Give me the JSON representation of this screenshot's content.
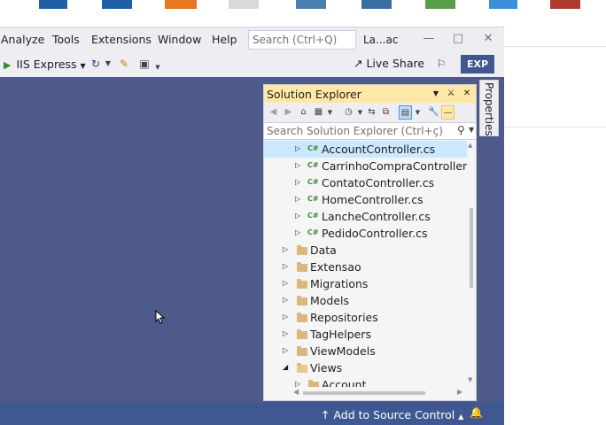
{
  "menu": {
    "items": [
      "Analyze",
      "Tools",
      "Extensions",
      "Window",
      "Help"
    ],
    "search_placeholder": "Search (Ctrl+Q)",
    "window_title": "La...ac"
  },
  "toolbar": {
    "run_label": "IIS Express",
    "live_share_label": "Live Share",
    "exp_badge": "EXP"
  },
  "properties_tab": "Properties",
  "solution_explorer": {
    "title": "Solution Explorer",
    "search_placeholder": "Search Solution Explorer (Ctrl+ç)",
    "cs_icon": "C#",
    "tree": [
      {
        "label": "AccountController.cs",
        "kind": "cs",
        "selected": true
      },
      {
        "label": "CarrinhoCompraController.cs",
        "kind": "cs"
      },
      {
        "label": "ContatoController.cs",
        "kind": "cs"
      },
      {
        "label": "HomeController.cs",
        "kind": "cs"
      },
      {
        "label": "LancheController.cs",
        "kind": "cs"
      },
      {
        "label": "PedidoController.cs",
        "kind": "cs"
      },
      {
        "label": "Data",
        "kind": "folder"
      },
      {
        "label": "Extensao",
        "kind": "folder"
      },
      {
        "label": "Migrations",
        "kind": "folder"
      },
      {
        "label": "Models",
        "kind": "folder"
      },
      {
        "label": "Repositories",
        "kind": "folder"
      },
      {
        "label": "TagHelpers",
        "kind": "folder"
      },
      {
        "label": "ViewModels",
        "kind": "folder"
      },
      {
        "label": "Views",
        "kind": "folder",
        "expanded": true
      },
      {
        "label": "Account",
        "kind": "subfolder"
      }
    ]
  },
  "status_bar": {
    "source_control": "Add to Source Control"
  },
  "colors": {
    "editor_bg": "#4d5a8a",
    "status_bar": "#3f5891",
    "panel_title_active": "#ffe8a6",
    "selection": "#cce8ff",
    "accent": "#007acc"
  }
}
